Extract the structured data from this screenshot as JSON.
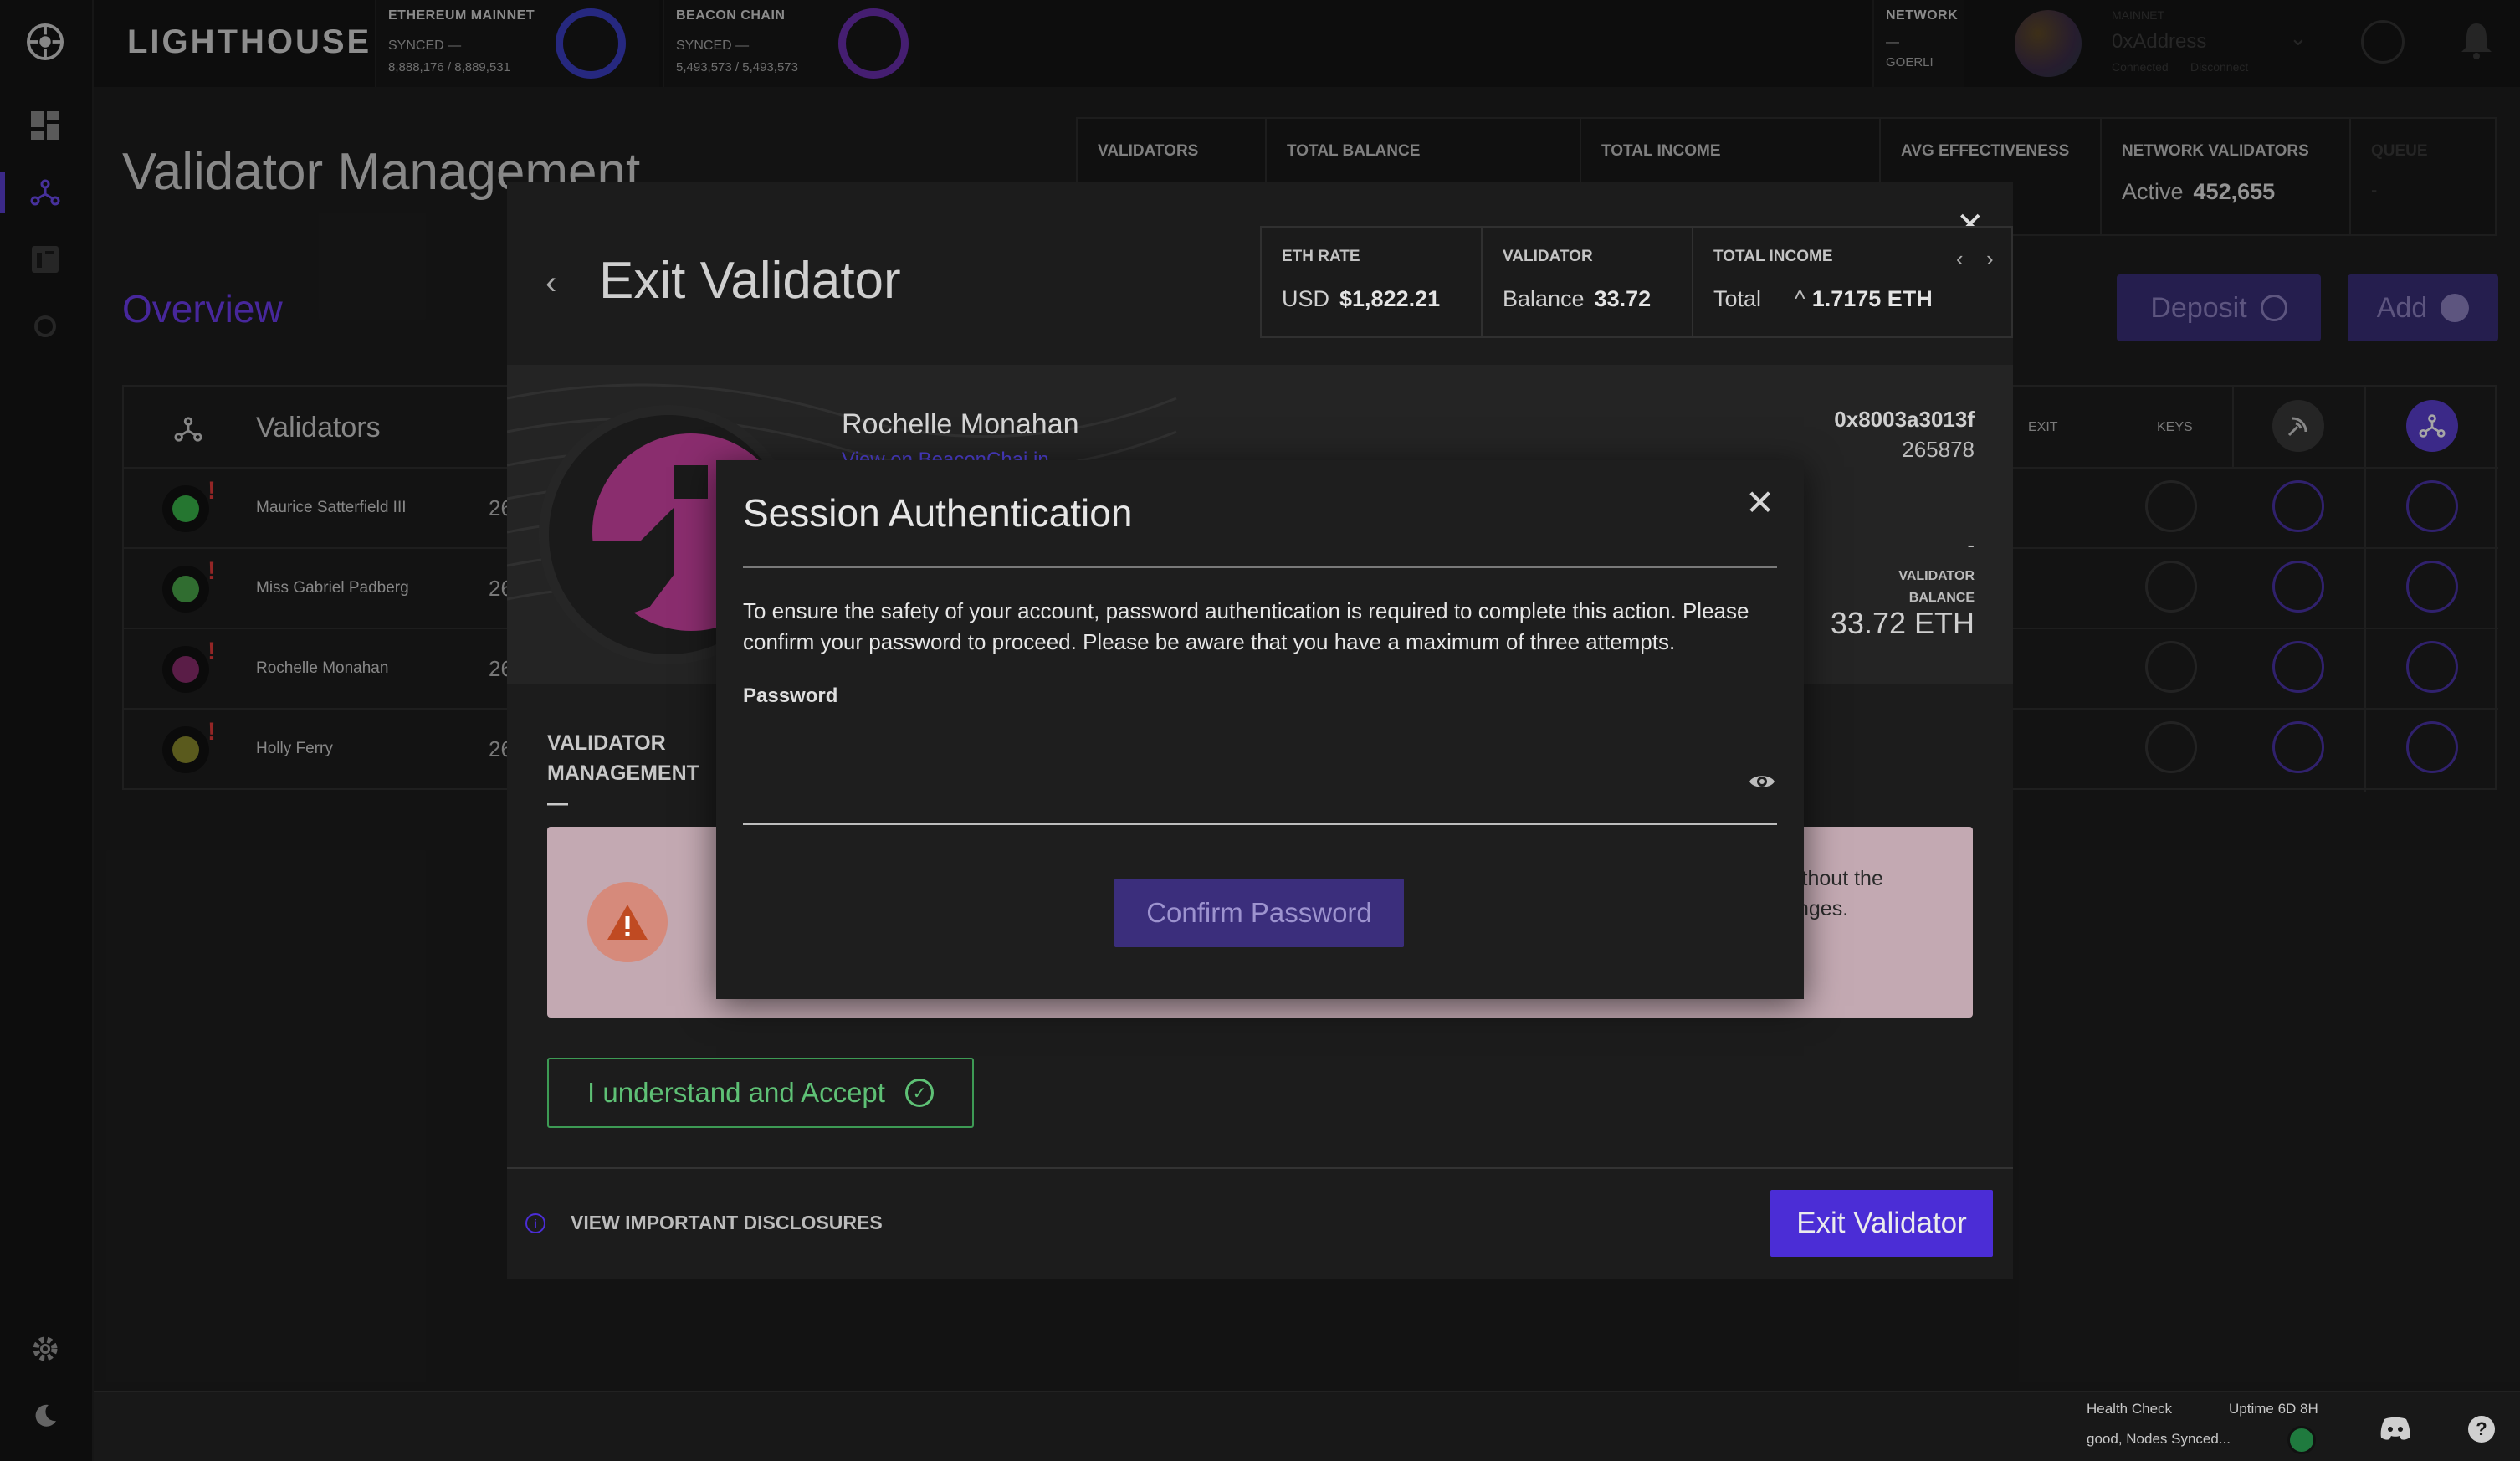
{
  "brand": "LIGHTHOUSE",
  "header": {
    "eth": {
      "title": "ETHEREUM MAINNET",
      "status": "SYNCED —",
      "progress": "8,888,176 / 8,889,531"
    },
    "beacon": {
      "title": "BEACON CHAIN",
      "status": "SYNCED —",
      "progress": "5,493,573 / 5,493,573"
    },
    "network": {
      "title": "NETWORK",
      "dash": "—",
      "value": "GOERLI"
    },
    "account": {
      "net": "MAINNET",
      "address": "0xAddress",
      "connected": "Connected",
      "disconnect": "Disconnect"
    }
  },
  "page": {
    "title": "Validator Management",
    "overview": "Overview",
    "deposit": "Deposit",
    "add": "Add"
  },
  "stats": {
    "validators": "VALIDATORS",
    "total_balance": "TOTAL BALANCE",
    "total_income": "TOTAL INCOME",
    "avg_eff": "AVG EFFECTIVENESS",
    "avg_eff_val": "%",
    "network_validators": "NETWORK VALIDATORS",
    "active_label": "Active",
    "active_value": "452,655",
    "queue": "QUEUE",
    "queue_val": "-"
  },
  "table": {
    "header": "Validators",
    "exit": "EXIT",
    "keys": "KEYS",
    "rows": [
      {
        "name": "Maurice Satterfield III",
        "num": "26"
      },
      {
        "name": "Miss Gabriel Padberg",
        "num": "26"
      },
      {
        "name": "Rochelle Monahan",
        "num": "26"
      },
      {
        "name": "Holly Ferry",
        "num": "26"
      }
    ]
  },
  "exit_panel": {
    "title": "Exit Validator",
    "eth_rate_label": "ETH RATE",
    "usd": "USD",
    "usd_value": "$1,822.21",
    "validator_label": "VALIDATOR",
    "balance": "Balance",
    "balance_value": "33.72",
    "total_income_label": "TOTAL INCOME",
    "total": "Total",
    "total_value": "1.7175 ETH",
    "validator_name": "Rochelle Monahan",
    "beaconchain": "View on BeaconChai.in",
    "pubkey": "0x8003a3013f",
    "index": "265878",
    "dash": "-",
    "validator_balance_label": "VALIDATOR BALANCE",
    "validator_balance_value": "33.72 ETH",
    "mgmt_label": "VALIDATOR MANAGEMENT —",
    "warn_tail_1": "ithout the",
    "warn_tail_2": "nges.",
    "accept": "I understand and Accept",
    "disclosures": "VIEW IMPORTANT DISCLOSURES",
    "exit_button": "Exit Validator"
  },
  "modal": {
    "title": "Session Authentication",
    "description": "To ensure the safety of your account, password authentication is required to complete this action. Please confirm your password to proceed. Please be aware that you have a maximum of three attempts.",
    "password_label": "Password",
    "password_value": "",
    "confirm": "Confirm Password"
  },
  "footer": {
    "health_label": "Health Check",
    "health_value": "good, Nodes Synced...",
    "uptime": "Uptime 6D 8H"
  },
  "colors": {
    "accent": "#5b3fd1",
    "success": "#3d9a54",
    "warning": "#d68a7b"
  }
}
